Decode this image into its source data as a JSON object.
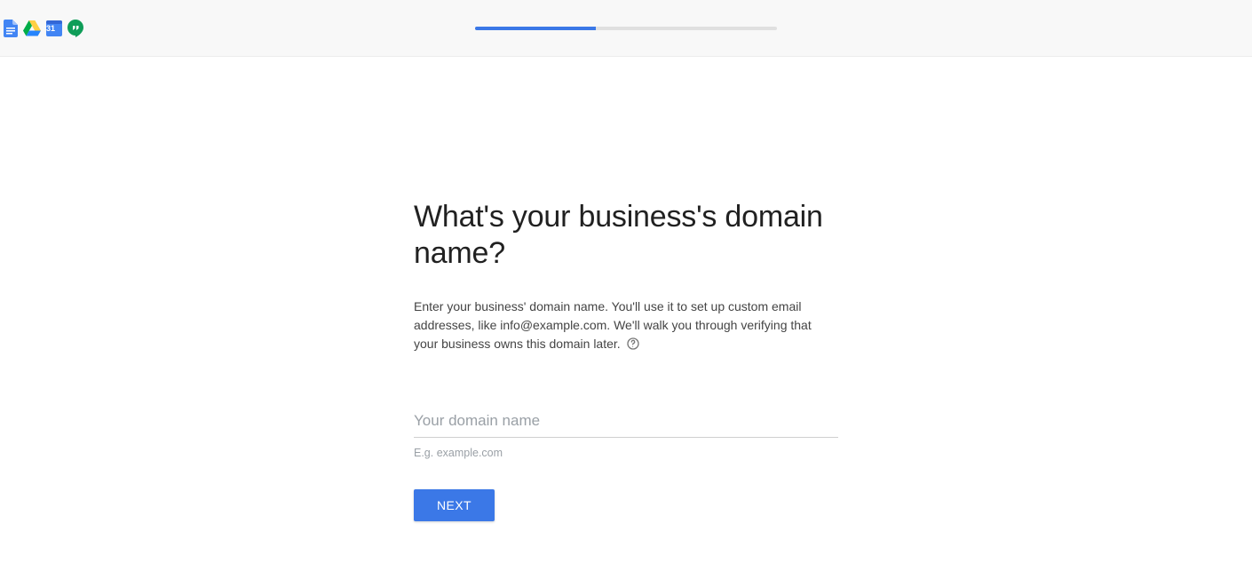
{
  "progress": {
    "percent": 40
  },
  "main": {
    "title": "What's your business's domain name?",
    "description": "Enter your business' domain name. You'll use it to set up custom email addresses, like info@example.com. We'll walk you through verifying that your business owns this domain later.",
    "domain_placeholder": "Your domain name",
    "domain_hint": "E.g. example.com",
    "next_label": "NEXT"
  },
  "icons": {
    "calendar_day": "31"
  }
}
